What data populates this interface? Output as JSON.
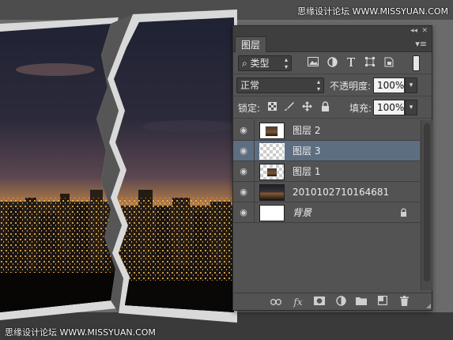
{
  "watermarks": {
    "top": "思缘设计论坛 WWW.MISSYUAN.COM",
    "bottom": "思缘设计论坛 WWW.MISSYUAN.COM"
  },
  "panel": {
    "collapse_glyph": "◂◂",
    "close_glyph": "✕",
    "tab_label": "图层",
    "menu_glyph": "▾≡",
    "filter": {
      "kind_label": "类型",
      "icons": [
        "image-filter-icon",
        "adjustment-filter-icon",
        "type-filter-icon",
        "shape-filter-icon",
        "smart-object-filter-icon"
      ]
    },
    "blend_mode": "正常",
    "opacity_label": "不透明度:",
    "opacity_value": "100%",
    "lock_label": "锁定:",
    "fill_label": "填充:",
    "fill_value": "100%",
    "layers": [
      {
        "name": "图层 2",
        "thumb": "photo",
        "selected": false,
        "visible": true
      },
      {
        "name": "图层 3",
        "thumb": "transparent",
        "selected": true,
        "visible": true
      },
      {
        "name": "图层 1",
        "thumb": "photo-small",
        "selected": false,
        "visible": true
      },
      {
        "name": "2010102710164681",
        "thumb": "city",
        "selected": false,
        "visible": true
      },
      {
        "name": "背景",
        "thumb": "white",
        "selected": false,
        "visible": true,
        "locked": true
      }
    ],
    "bottom_icons": [
      "link-icon",
      "fx-icon",
      "mask-icon",
      "adjustment-layer-icon",
      "folder-icon",
      "new-layer-icon",
      "trash-icon"
    ],
    "fx_label": "fx"
  },
  "colors": {
    "panel_bg": "#535353",
    "selected_row": "#5d6e80",
    "canvas_bg": "#6a6a6a"
  }
}
